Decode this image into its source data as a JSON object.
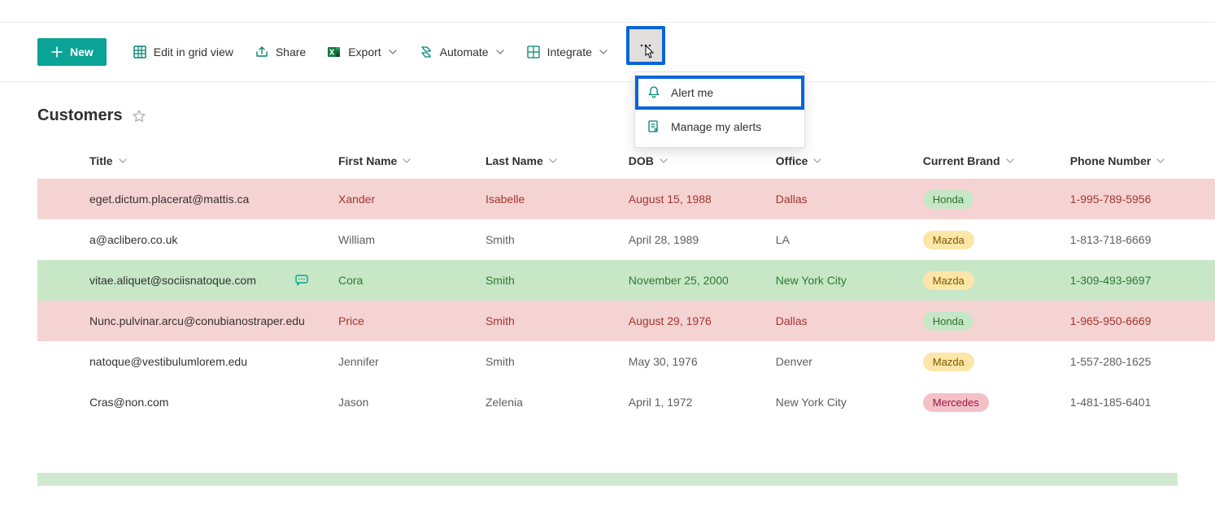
{
  "toolbar": {
    "new": "New",
    "edit_grid": "Edit in grid view",
    "share": "Share",
    "export": "Export",
    "automate": "Automate",
    "integrate": "Integrate"
  },
  "dropdown": {
    "alert_me": "Alert me",
    "manage_alerts": "Manage my alerts"
  },
  "page_title": "Customers",
  "columns": {
    "title": "Title",
    "first_name": "First Name",
    "last_name": "Last Name",
    "dob": "DOB",
    "office": "Office",
    "brand": "Current Brand",
    "phone": "Phone Number"
  },
  "rows": [
    {
      "title": "eget.dictum.placerat@mattis.ca",
      "first_name": "Xander",
      "last_name": "Isabelle",
      "dob": "August 15, 1988",
      "office": "Dallas",
      "brand": "Honda",
      "brand_tag": "green",
      "phone": "1-995-789-5956",
      "row_style": "pink",
      "has_comment": false
    },
    {
      "title": "a@aclibero.co.uk",
      "first_name": "William",
      "last_name": "Smith",
      "dob": "April 28, 1989",
      "office": "LA",
      "brand": "Mazda",
      "brand_tag": "yellow",
      "phone": "1-813-718-6669",
      "row_style": "",
      "has_comment": false
    },
    {
      "title": "vitae.aliquet@sociisnatoque.com",
      "first_name": "Cora",
      "last_name": "Smith",
      "dob": "November 25, 2000",
      "office": "New York City",
      "brand": "Mazda",
      "brand_tag": "yellow",
      "phone": "1-309-493-9697",
      "row_style": "green",
      "has_comment": true
    },
    {
      "title": "Nunc.pulvinar.arcu@conubianostraper.edu",
      "first_name": "Price",
      "last_name": "Smith",
      "dob": "August 29, 1976",
      "office": "Dallas",
      "brand": "Honda",
      "brand_tag": "green",
      "phone": "1-965-950-6669",
      "row_style": "pink",
      "has_comment": false
    },
    {
      "title": "natoque@vestibulumlorem.edu",
      "first_name": "Jennifer",
      "last_name": "Smith",
      "dob": "May 30, 1976",
      "office": "Denver",
      "brand": "Mazda",
      "brand_tag": "yellow",
      "phone": "1-557-280-1625",
      "row_style": "",
      "has_comment": false
    },
    {
      "title": "Cras@non.com",
      "first_name": "Jason",
      "last_name": "Zelenia",
      "dob": "April 1, 1972",
      "office": "New York City",
      "brand": "Mercedes",
      "brand_tag": "pink",
      "phone": "1-481-185-6401",
      "row_style": "",
      "has_comment": false
    }
  ]
}
